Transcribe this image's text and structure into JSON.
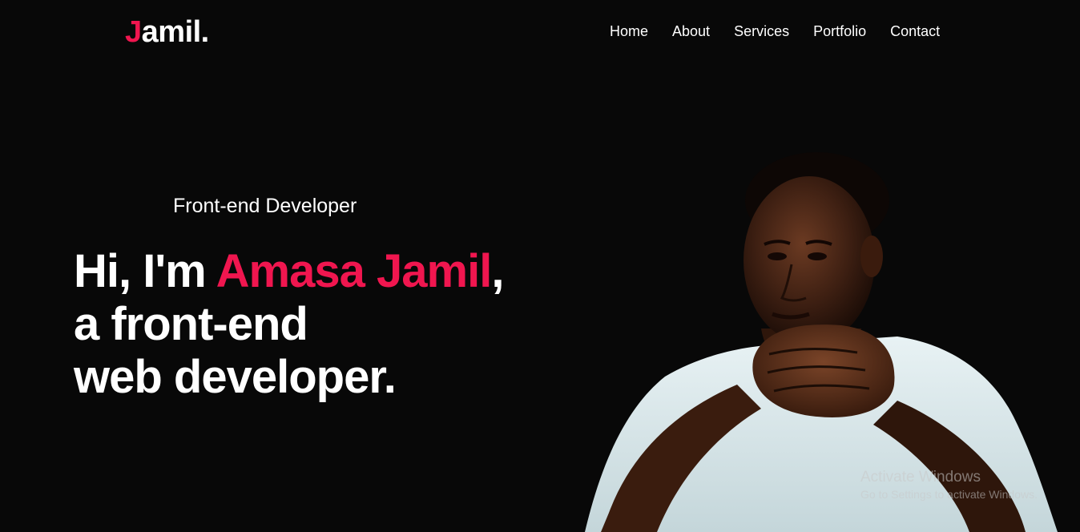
{
  "brand": {
    "initial": "J",
    "rest": "amil."
  },
  "nav": {
    "items": [
      "Home",
      "About",
      "Services",
      "Portfolio",
      "Contact"
    ]
  },
  "hero": {
    "subtitle": "Front-end Developer",
    "line1_prefix": "Hi, I'm ",
    "name": "Amasa Jamil",
    "line1_suffix": ",",
    "line2": "a front-end",
    "line3": "web developer."
  },
  "watermark": {
    "title": "Activate Windows",
    "subtitle": "Go to Settings to activate Windows."
  },
  "colors": {
    "background": "#080808",
    "accent": "#f0164f",
    "text": "#ffffff"
  }
}
